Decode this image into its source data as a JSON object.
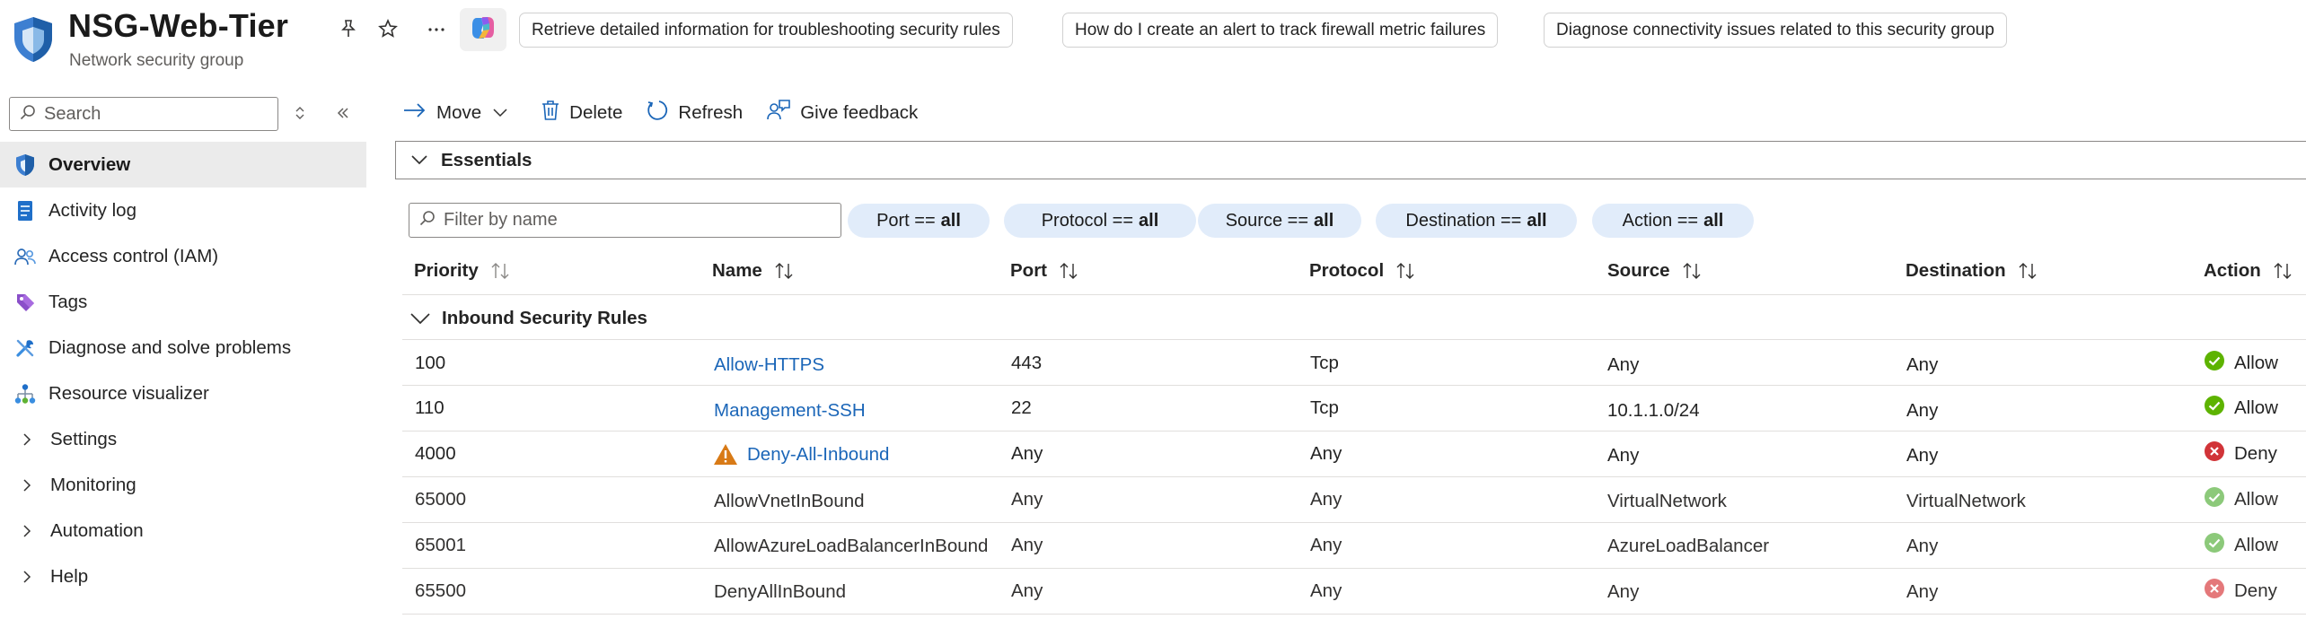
{
  "header": {
    "title": "NSG-Web-Tier",
    "subtitle": "Network security group",
    "suggestions": [
      "Retrieve detailed information for troubleshooting security rules",
      "How do I create an alert to track firewall metric failures",
      "Diagnose connectivity issues related to this security group"
    ]
  },
  "sidebar": {
    "search_placeholder": "Search",
    "items": [
      {
        "label": "Overview",
        "icon": "shield-icon"
      },
      {
        "label": "Activity log",
        "icon": "activity-log-icon"
      },
      {
        "label": "Access control (IAM)",
        "icon": "people-icon"
      },
      {
        "label": "Tags",
        "icon": "tag-icon"
      },
      {
        "label": "Diagnose and solve problems",
        "icon": "wrench-icon"
      },
      {
        "label": "Resource visualizer",
        "icon": "hierarchy-icon"
      },
      {
        "label": "Settings",
        "icon": "chevron-right-icon"
      },
      {
        "label": "Monitoring",
        "icon": "chevron-right-icon"
      },
      {
        "label": "Automation",
        "icon": "chevron-right-icon"
      },
      {
        "label": "Help",
        "icon": "chevron-right-icon"
      }
    ]
  },
  "toolbar": {
    "move": "Move",
    "delete": "Delete",
    "refresh": "Refresh",
    "feedback": "Give feedback"
  },
  "essentials_label": "Essentials",
  "filter": {
    "placeholder": "Filter by name",
    "pills": [
      {
        "key": "Port ==",
        "value": "all"
      },
      {
        "key": "Protocol ==",
        "value": "all"
      },
      {
        "key": "Source ==",
        "value": "all"
      },
      {
        "key": "Destination ==",
        "value": "all"
      },
      {
        "key": "Action ==",
        "value": "all"
      }
    ]
  },
  "table": {
    "columns": [
      "Priority",
      "Name",
      "Port",
      "Protocol",
      "Source",
      "Destination",
      "Action"
    ],
    "group_label": "Inbound Security Rules",
    "rows": [
      {
        "priority": "100",
        "name": "Allow-HTTPS",
        "port": "443",
        "protocol": "Tcp",
        "source": "Any",
        "destination": "Any",
        "action": "Allow"
      },
      {
        "priority": "110",
        "name": "Management-SSH",
        "port": "22",
        "protocol": "Tcp",
        "source": "10.1.1.0/24",
        "destination": "Any",
        "action": "Allow"
      },
      {
        "priority": "4000",
        "name": "Deny-All-Inbound",
        "port": "Any",
        "protocol": "Any",
        "source": "Any",
        "destination": "Any",
        "action": "Deny"
      },
      {
        "priority": "65000",
        "name": "AllowVnetInBound",
        "port": "Any",
        "protocol": "Any",
        "source": "VirtualNetwork",
        "destination": "VirtualNetwork",
        "action": "Allow"
      },
      {
        "priority": "65001",
        "name": "AllowAzureLoadBalancerInBound",
        "port": "Any",
        "protocol": "Any",
        "source": "AzureLoadBalancer",
        "destination": "Any",
        "action": "Allow"
      },
      {
        "priority": "65500",
        "name": "DenyAllInBound",
        "port": "Any",
        "protocol": "Any",
        "source": "Any",
        "destination": "Any",
        "action": "Deny"
      }
    ]
  },
  "colors": {
    "link": "#1b66b8",
    "allow": "#5db300",
    "allow_muted": "#8cc97a",
    "deny": "#d13438",
    "deny_muted": "#e4787a",
    "warning": "#d87a16",
    "pill_bg": "#e1ecfa"
  }
}
